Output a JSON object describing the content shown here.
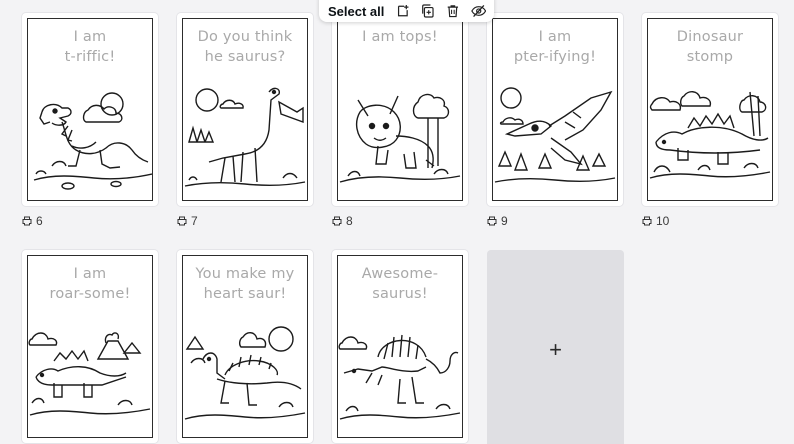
{
  "toolbar": {
    "select_all": "Select all",
    "icons": [
      "add-page-icon",
      "duplicate-page-icon",
      "trash-icon",
      "hide-icon"
    ]
  },
  "pages": [
    {
      "number": "6",
      "title": "I am\nt-riffic!",
      "art": "t-rex"
    },
    {
      "number": "7",
      "title": "Do you think\nhe saurus?",
      "art": "brachiosaurus"
    },
    {
      "number": "8",
      "title": "I am tops!",
      "art": "triceratops"
    },
    {
      "number": "9",
      "title": "I am\npter-ifying!",
      "art": "pterodactyl"
    },
    {
      "number": "10",
      "title": "Dinosaur\nstomp",
      "art": "stegosaurus"
    },
    {
      "number": "",
      "title": "I am\nroar-some!",
      "art": "stegosaurus-volcano"
    },
    {
      "number": "",
      "title": "You make my\nheart saur!",
      "art": "dimetrodon"
    },
    {
      "number": "",
      "title": "Awesome-\nsaurus!",
      "art": "spinosaurus"
    }
  ],
  "add_page": {
    "label": "+"
  },
  "colors": {
    "background": "#f3f3f5",
    "add_tile": "#dfdfe3",
    "title_text": "#a9a9a9"
  }
}
